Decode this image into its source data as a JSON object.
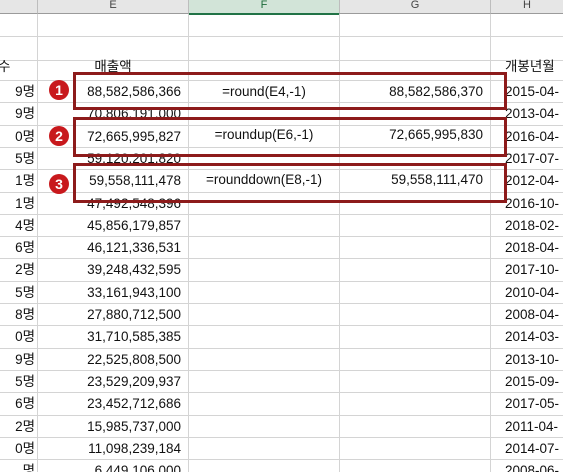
{
  "columns": [
    "E",
    "F",
    "G",
    "H"
  ],
  "header_row": {
    "d": "수",
    "e": "매출액",
    "h": "개봉년월"
  },
  "rows": [
    {
      "d": "9명",
      "e": "88,582,586,366",
      "h": "2015-04-"
    },
    {
      "d": "9명",
      "e": "70,806,191,000",
      "h": "2013-04-"
    },
    {
      "d": "0명",
      "e": "72,665,995,827",
      "h": "2016-04-"
    },
    {
      "d": "5명",
      "e": "59,120,201,820",
      "h": "2017-07-"
    },
    {
      "d": "1명",
      "e": "59,558,111,478",
      "h": "2012-04-"
    },
    {
      "d": "1명",
      "e": "47,492,548,396",
      "h": "2016-10-"
    },
    {
      "d": "4명",
      "e": "45,856,179,857",
      "h": "2018-02-"
    },
    {
      "d": "6명",
      "e": "46,121,336,531",
      "h": "2018-04-"
    },
    {
      "d": "2명",
      "e": "39,248,432,595",
      "h": "2017-10-"
    },
    {
      "d": "5명",
      "e": "33,161,943,100",
      "h": "2010-04-"
    },
    {
      "d": "8명",
      "e": "27,880,712,500",
      "h": "2008-04-"
    },
    {
      "d": "0명",
      "e": "31,710,585,385",
      "h": "2014-03-"
    },
    {
      "d": "9명",
      "e": "22,525,808,500",
      "h": "2013-10-"
    },
    {
      "d": "5명",
      "e": "23,529,209,937",
      "h": "2015-09-"
    },
    {
      "d": "6명",
      "e": "23,452,712,686",
      "h": "2017-05-"
    },
    {
      "d": "2명",
      "e": "15,985,737,000",
      "h": "2011-04-"
    },
    {
      "d": "0명",
      "e": "11,098,239,184",
      "h": "2014-07-"
    },
    {
      "d": "명",
      "e": "6,449,106,000",
      "h": "2008-06-"
    }
  ],
  "examples": [
    {
      "badge": "1",
      "formula": "=round(E4,-1)",
      "result": "88,582,586,370"
    },
    {
      "badge": "2",
      "formula": "=roundup(E6,-1)",
      "result": "72,665,995,830"
    },
    {
      "badge": "3",
      "formula": "=rounddown(E8,-1)",
      "result": "59,558,111,470"
    }
  ]
}
